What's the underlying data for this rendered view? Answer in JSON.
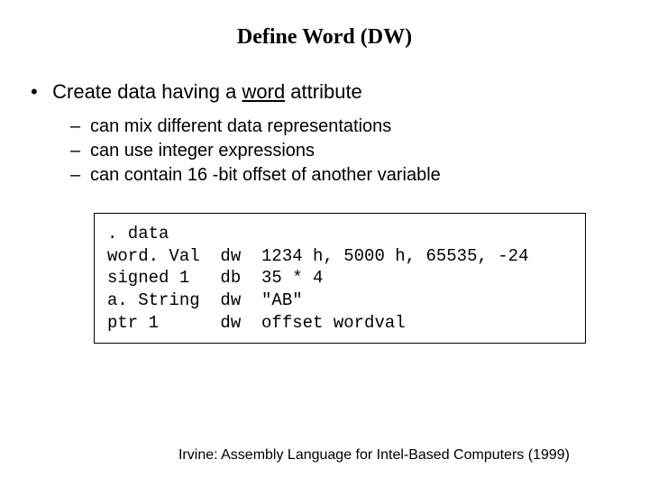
{
  "title": "Define Word (DW)",
  "bullet": {
    "prefix": "Create data having a ",
    "underlined": "word",
    "suffix": " attribute"
  },
  "sub_items": [
    "can mix different data representations",
    "can use integer expressions",
    "can contain 16 -bit offset of another variable"
  ],
  "code": ". data\nword. Val  dw  1234 h, 5000 h, 65535, -24\nsigned 1   db  35 * 4\na. String  dw  \"AB\"\nptr 1      dw  offset wordval",
  "footer": "Irvine: Assembly Language for Intel-Based Computers (1999)"
}
